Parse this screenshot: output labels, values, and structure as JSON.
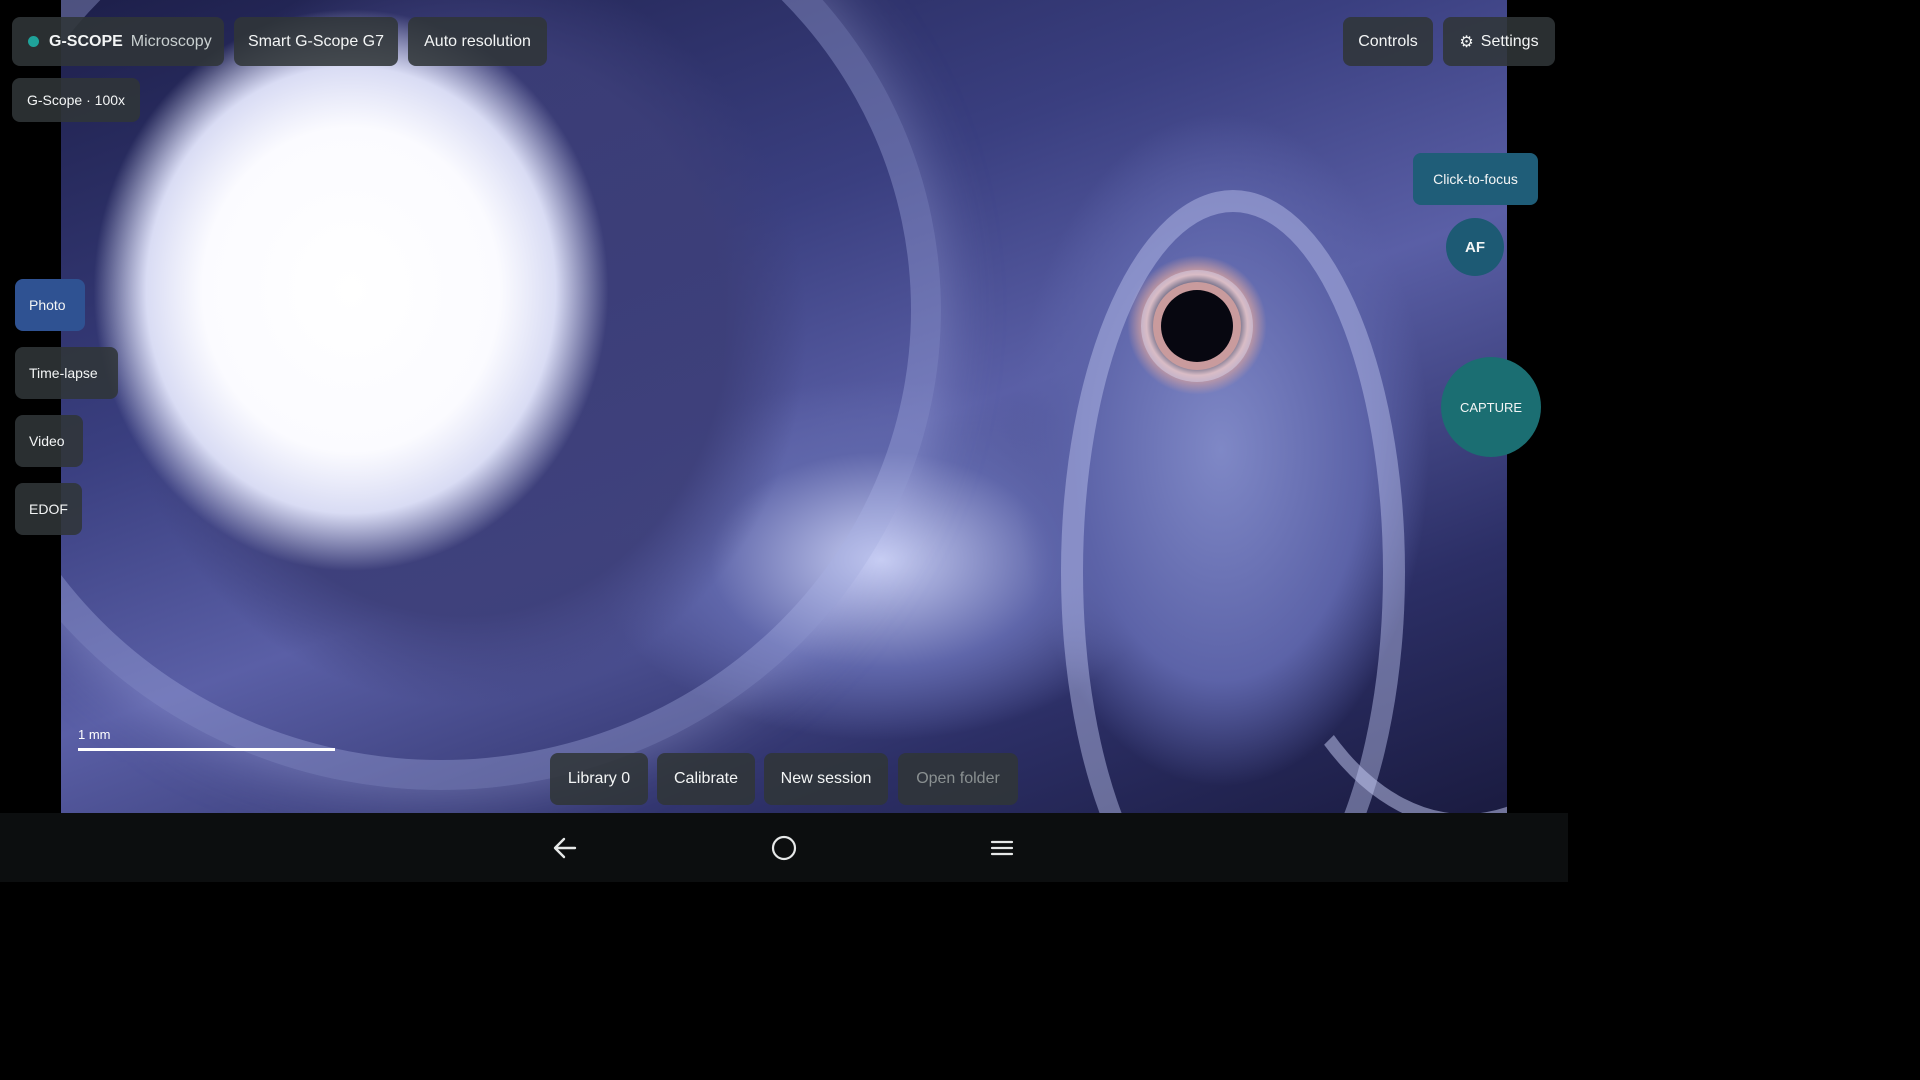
{
  "brand": {
    "name": "G-SCOPE",
    "subtitle": "Microscopy",
    "status_color": "#1fa39a"
  },
  "toolbar": {
    "device": "Smart G-Scope G7",
    "resolution": "Auto resolution",
    "controls": "Controls",
    "settings": "Settings",
    "settings_icon": "gear-icon"
  },
  "badge": {
    "label": "G-Scope · 100x"
  },
  "modes": [
    {
      "label": "Photo",
      "active": true
    },
    {
      "label": "Time-lapse",
      "active": false
    },
    {
      "label": "Video",
      "active": false
    },
    {
      "label": "EDOF",
      "active": false
    }
  ],
  "right_controls": {
    "focus": "Click-to-focus",
    "af": "AF",
    "capture": "CAPTURE"
  },
  "scale": {
    "label": "1 mm"
  },
  "bottom_actions": {
    "library": "Library 0",
    "calibrate": "Calibrate",
    "new_session": "New session",
    "open_folder": "Open folder"
  },
  "nav_icons": [
    "back-icon",
    "home-icon",
    "menu-icon"
  ],
  "colors": {
    "active_mode": "#2f5292",
    "capture": "#1b6e72",
    "focus": "#1f5d78"
  }
}
